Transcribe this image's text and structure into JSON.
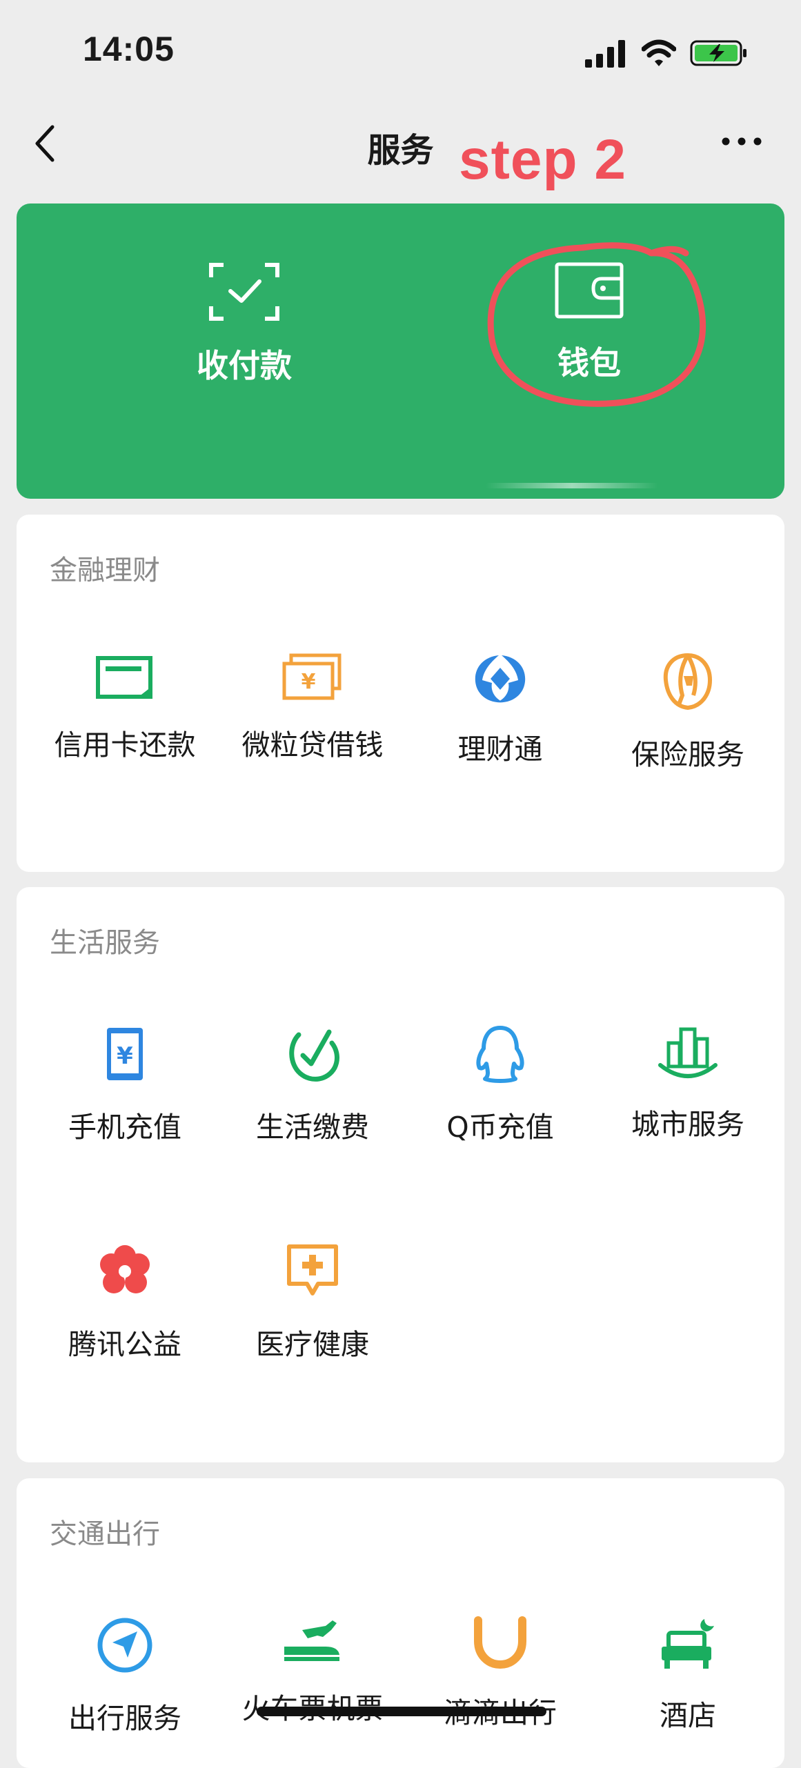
{
  "status_bar": {
    "time": "14:05"
  },
  "nav": {
    "title": "服务"
  },
  "annotation": {
    "text": "step 2"
  },
  "header": {
    "tiles": [
      {
        "label": "收付款",
        "icon": "scan-check-icon"
      },
      {
        "label": "钱包",
        "icon": "wallet-icon"
      }
    ]
  },
  "sections": [
    {
      "title": "金融理财",
      "items": [
        {
          "label": "信用卡还款",
          "icon": "credit-card-icon",
          "color": "#1aad5f"
        },
        {
          "label": "微粒贷借钱",
          "icon": "yuan-bill-icon",
          "color": "#f3a23c"
        },
        {
          "label": "理财通",
          "icon": "licaitong-icon",
          "color": "#2e86e0"
        },
        {
          "label": "保险服务",
          "icon": "insurance-icon",
          "color": "#f3a23c"
        }
      ]
    },
    {
      "title": "生活服务",
      "items": [
        {
          "label": "手机充值",
          "icon": "phone-yuan-icon",
          "color": "#2e86e0"
        },
        {
          "label": "生活缴费",
          "icon": "bill-check-icon",
          "color": "#1aad5f"
        },
        {
          "label": "Q币充值",
          "icon": "penguin-icon",
          "color": "#2e9be6"
        },
        {
          "label": "城市服务",
          "icon": "city-buildings-icon",
          "color": "#1aad5f"
        },
        {
          "label": "腾讯公益",
          "icon": "flower-icon",
          "color": "#ef4b4b"
        },
        {
          "label": "医疗健康",
          "icon": "medical-cross-icon",
          "color": "#f3a23c"
        }
      ]
    },
    {
      "title": "交通出行",
      "items": [
        {
          "label": "出行服务",
          "icon": "navigation-arrow-icon",
          "color": "#2e9be6"
        },
        {
          "label": "火车票机票",
          "icon": "train-plane-icon",
          "color": "#1aad5f"
        },
        {
          "label": "滴滴出行",
          "icon": "didi-icon",
          "color": "#f3a23c"
        },
        {
          "label": "酒店",
          "icon": "hotel-bed-icon",
          "color": "#1aad5f"
        }
      ]
    }
  ]
}
